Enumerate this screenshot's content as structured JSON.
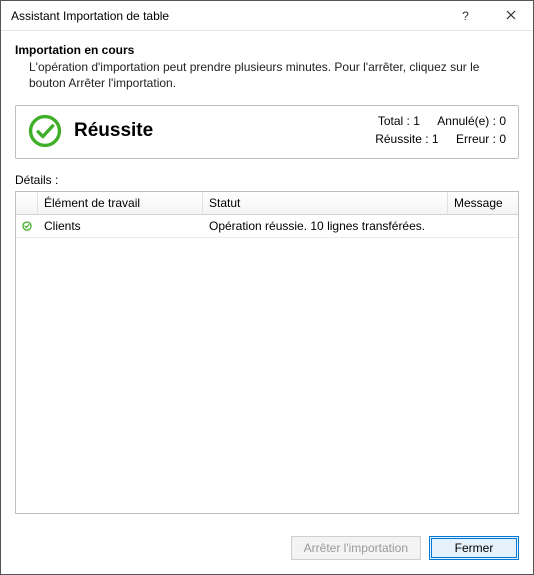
{
  "window": {
    "title": "Assistant Importation de table"
  },
  "heading": {
    "title": "Importation en cours",
    "description": "L'opération d'importation peut prendre plusieurs minutes. Pour l'arrêter, cliquez sur le bouton Arrêter l'importation."
  },
  "banner": {
    "title": "Réussite",
    "stats": {
      "total_label": "Total :",
      "total_value": "1",
      "cancelled_label": "Annulé(e) :",
      "cancelled_value": "0",
      "success_label": "Réussite :",
      "success_value": "1",
      "error_label": "Erreur :",
      "error_value": "0"
    }
  },
  "details": {
    "label": "Détails :",
    "columns": {
      "work_item": "Élément de travail",
      "status": "Statut",
      "message": "Message"
    },
    "rows": [
      {
        "work_item": "Clients",
        "status": "Opération réussie. 10 lignes transférées.",
        "message": ""
      }
    ]
  },
  "footer": {
    "stop_label": "Arrêter l'importation",
    "close_label": "Fermer"
  }
}
